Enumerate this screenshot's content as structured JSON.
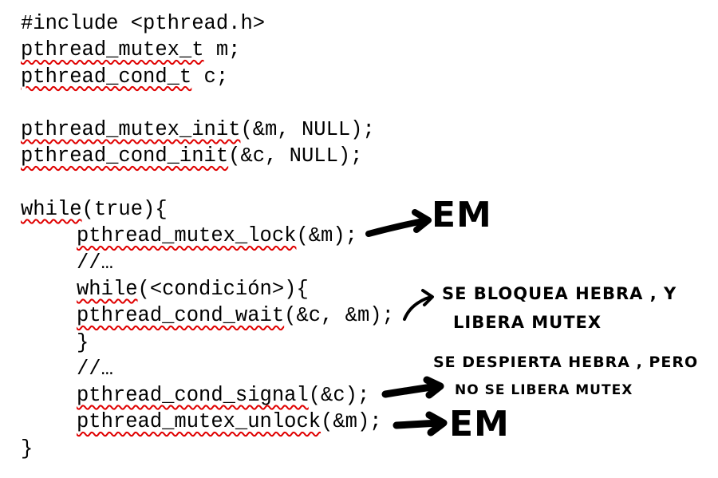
{
  "code_lines": [
    [
      {
        "t": "#include <pthread.h>"
      }
    ],
    [
      {
        "t": "pthread_mutex_t",
        "err": true
      },
      {
        "t": " m;"
      }
    ],
    [
      {
        "t": "pthread_cond_t",
        "err": true
      },
      {
        "t": " c;"
      }
    ],
    [],
    [
      {
        "t": "pthread_mutex_init",
        "err": true
      },
      {
        "t": "(&m, NULL);"
      }
    ],
    [
      {
        "t": "pthread_cond_init",
        "err": true
      },
      {
        "t": "(&c, NULL);"
      }
    ],
    [],
    [
      {
        "t": "while",
        "err": true
      },
      {
        "t": "(true){"
      }
    ],
    [
      {
        "t": "pthread_mutex_lock",
        "err": true
      },
      {
        "t": "(&m);"
      }
    ],
    [
      {
        "t": "//…"
      }
    ],
    [
      {
        "t": "while",
        "err": true
      },
      {
        "t": "(<condición>){"
      }
    ],
    [
      {
        "t": "pthread_cond_wait",
        "err": true
      },
      {
        "t": "(&c, &m);"
      }
    ],
    [
      {
        "t": "}"
      }
    ],
    [
      {
        "t": "//…"
      }
    ],
    [
      {
        "t": "pthread_cond_signal",
        "err": true
      },
      {
        "t": "(&c);"
      }
    ],
    [
      {
        "t": "pthread_mutex_unlock",
        "err": true
      },
      {
        "t": "(&m);"
      }
    ],
    [
      {
        "t": "}"
      }
    ]
  ],
  "indented_lines": [
    8,
    9,
    10,
    11,
    12,
    13,
    14,
    15
  ],
  "annotations": {
    "lock_note": "EM",
    "wait_note_1": "SE BLOQUEA HEBRA , Y",
    "wait_note_2": "LIBERA MUTEX",
    "signal_note_1": "SE DESPIERTA HEBRA , PERO",
    "signal_note_2": "NO SE LIBERA MUTEX",
    "unlock_note": "EM"
  },
  "colors": {
    "spellcheck_underline": "#e00000",
    "ink": "#000000"
  }
}
